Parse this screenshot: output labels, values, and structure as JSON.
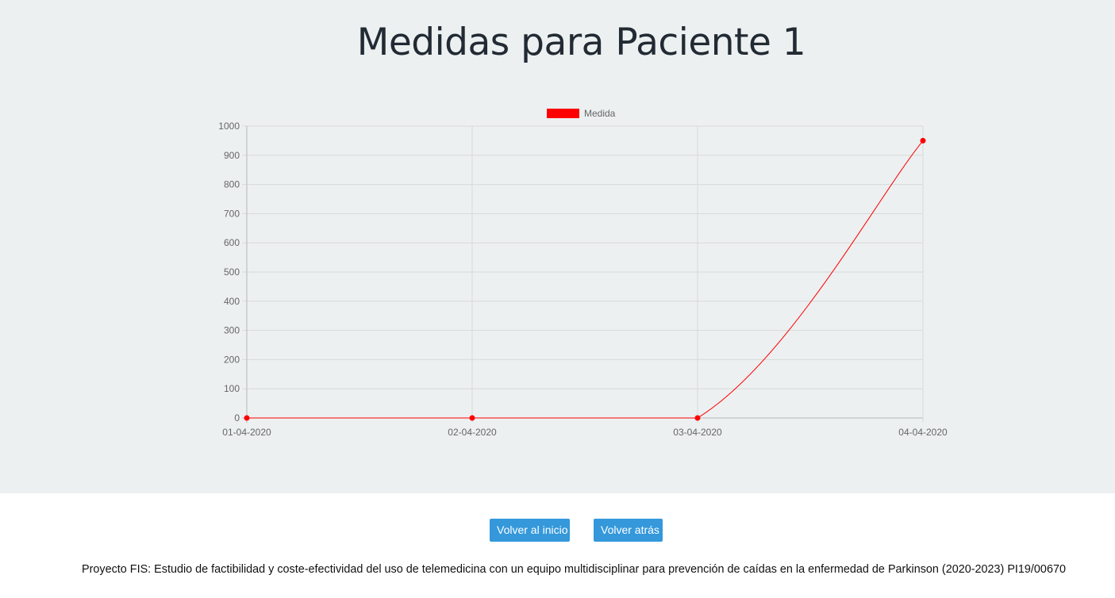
{
  "page": {
    "title": "Medidas para Paciente 1"
  },
  "chart_data": {
    "type": "line",
    "categories": [
      "01-04-2020",
      "02-04-2020",
      "03-04-2020",
      "04-04-2020"
    ],
    "series": [
      {
        "name": "Medida",
        "values": [
          0,
          0,
          0,
          950
        ],
        "color": "#ff0000"
      }
    ],
    "ylim": [
      0,
      1000
    ],
    "yticks": [
      0,
      100,
      200,
      300,
      400,
      500,
      600,
      700,
      800,
      900,
      1000
    ],
    "grid": true,
    "legend": "top-center",
    "title": "",
    "xlabel": "",
    "ylabel": ""
  },
  "buttons": {
    "home_label": "Volver al inicio",
    "back_label": "Volver atrás"
  },
  "footer": {
    "text": "Proyecto FIS: Estudio de factibilidad y coste-efectividad del uso de telemedicina con un equipo multidisciplinar para prevención de caídas en la enfermedad de Parkinson (2020-2023) PI19/00670"
  },
  "colors": {
    "hero_background": "#ecf0f1",
    "button": "#3498db",
    "series": "#ff0000"
  }
}
